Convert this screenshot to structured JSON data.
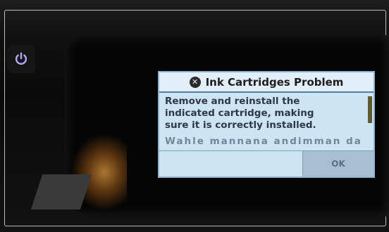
{
  "dialog": {
    "title": "Ink Cartridges Problem",
    "message_lines": [
      "Remove and reinstall the",
      "indicated cartridge, making",
      "sure it is correctly installed."
    ],
    "partial_line": "Wahle mannana andimman da",
    "ok_label": "OK"
  },
  "icons": {
    "power": "power-icon",
    "dialog_error": "error-x-icon"
  },
  "colors": {
    "power_glyph": "#b9a6ff",
    "dialog_bg": "#cfe4f3",
    "title_rule": "#4a7fae"
  }
}
